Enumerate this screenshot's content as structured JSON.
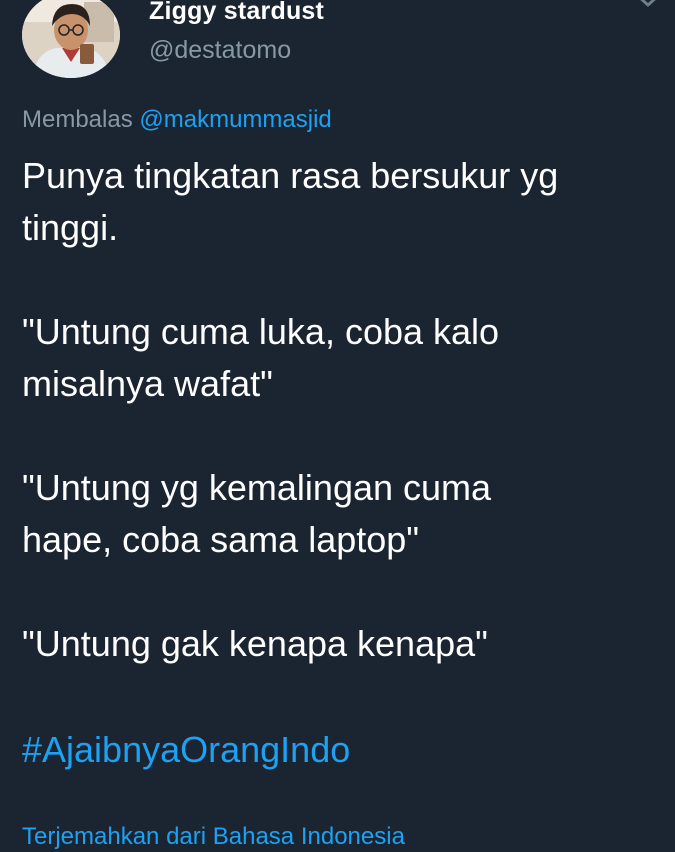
{
  "tweet": {
    "author": {
      "display_name": "Ziggy stardust",
      "handle": "@destatomo"
    },
    "reply": {
      "prefix": "Membalas",
      "mention": "@makmummasjid"
    },
    "paragraphs": [
      "Punya tingkatan rasa bersukur yg\ntinggi.",
      "\"Untung cuma luka, coba kalo\nmisalnya wafat\"",
      "\"Untung yg kemalingan cuma\nhape, coba sama laptop\"",
      "\"Untung gak kenapa kenapa\""
    ],
    "hashtag": "#AjaibnyaOrangIndo",
    "translate_link": "Terjemahkan dari Bahasa Indonesia"
  },
  "icons": {
    "avatar": "profile-photo",
    "menu": "chevron-down-icon"
  },
  "colors": {
    "background": "#1b2431",
    "text": "#ffffff",
    "secondary": "#8899a6",
    "accent": "#1da1f2"
  }
}
